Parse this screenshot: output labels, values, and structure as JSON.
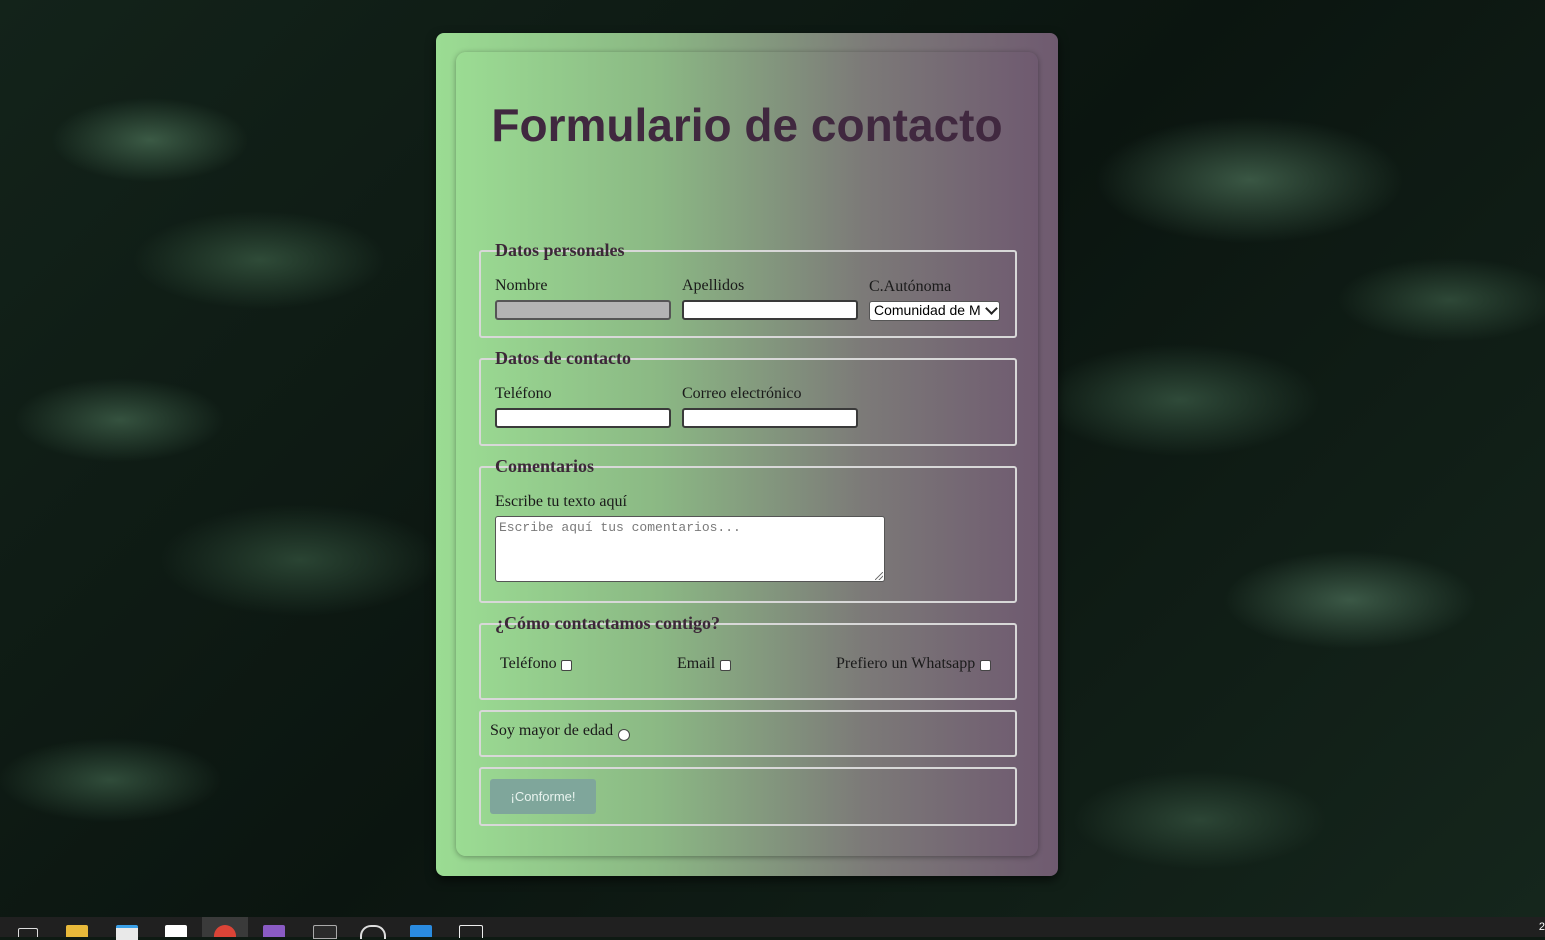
{
  "form": {
    "title": "Formulario de contacto",
    "personal": {
      "legend": "Datos personales",
      "nombre_label": "Nombre",
      "nombre_value": "",
      "apellidos_label": "Apellidos",
      "apellidos_value": "",
      "ca_label": "C.Autónoma",
      "ca_selected": "Comunidad de M"
    },
    "contact": {
      "legend": "Datos de contacto",
      "telefono_label": "Teléfono",
      "telefono_value": "",
      "email_label": "Correo electrónico",
      "email_value": ""
    },
    "comments": {
      "legend": "Comentarios",
      "label": "Escribe tu texto aquí",
      "placeholder": "Escribe aquí tus comentarios..."
    },
    "method": {
      "legend": "¿Cómo contactamos contigo?",
      "options": [
        "Teléfono",
        "Email",
        "Prefiero un Whatsapp"
      ]
    },
    "adult": {
      "label": "Soy mayor de edad"
    },
    "submit_label": "¡Conforme!"
  },
  "taskbar": {
    "clock_fragment": "2",
    "icons": [
      "task-view-icon",
      "file-explorer-icon",
      "store-icon",
      "mail-icon",
      "chrome-icon",
      "visual-studio-icon",
      "terminal-icon",
      "clock-app-icon",
      "vscode-icon",
      "photos-icon"
    ]
  },
  "colors": {
    "title": "#40283f",
    "card_gradient_start": "#9bdc93",
    "card_gradient_end": "#6f5a70",
    "button": "#7fa69b"
  }
}
